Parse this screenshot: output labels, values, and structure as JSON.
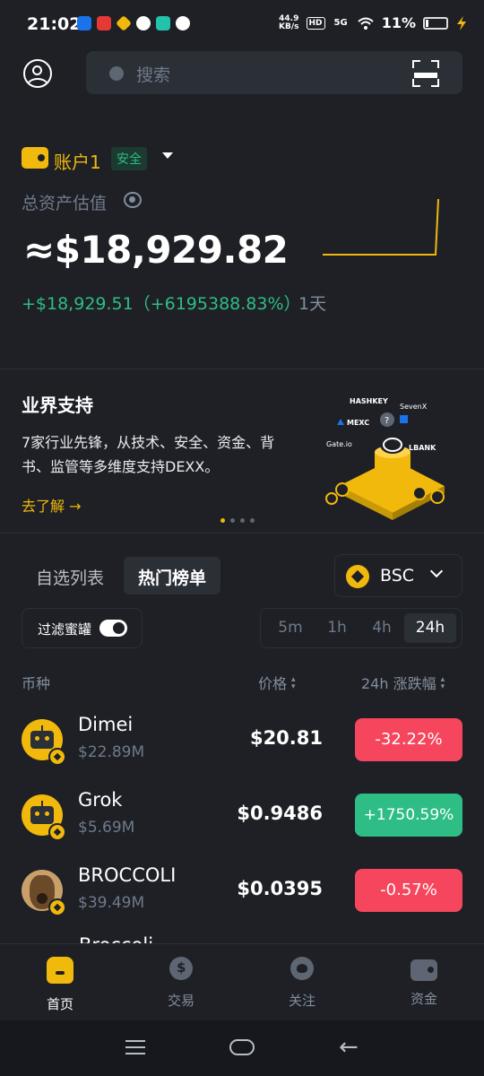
{
  "status_bar": {
    "time": "21:02",
    "net_speed_value": "44.9",
    "net_speed_unit": "KB/s",
    "hd_badge": "HD",
    "signal_label": "5G",
    "battery_pct": "11%",
    "app_icon_colors": [
      "#1a73e8",
      "#e53935",
      "#f0b90b",
      "#ffffff",
      "#22c3aa",
      "#ffffff"
    ]
  },
  "header": {
    "search_placeholder": "搜索"
  },
  "account": {
    "name": "账户1",
    "security_badge": "安全",
    "asset_label": "总资产估值",
    "balance": "≈$18,929.82",
    "pnl": "+$18,929.51（+6195388.83%）",
    "period": "1天"
  },
  "banner": {
    "title": "业界支持",
    "text": "7家行业先锋，从技术、安全、资金、背书、监管等多维度支持DEXX。",
    "link": "去了解",
    "partner_logos": [
      "HASHKEY",
      "SevenX",
      "MEXC",
      "Gate.io",
      "LBANK"
    ],
    "slide_count": 4,
    "active_slide": 1
  },
  "market": {
    "tabs": [
      "自选列表",
      "热门榜单"
    ],
    "active_tab": "热门榜单",
    "chain": "BSC",
    "filter_label": "过滤蜜罐",
    "filter_enabled": true,
    "timeframes": [
      "5m",
      "1h",
      "4h",
      "24h"
    ],
    "active_timeframe": "24h",
    "columns": {
      "token": "币种",
      "price": "价格",
      "change": "24h 涨跌幅"
    },
    "rows": [
      {
        "name": "Dimei",
        "market_cap": "$22.89M",
        "price": "$20.81",
        "change": "-32.22%",
        "direction": "down",
        "icon": "robot-icon"
      },
      {
        "name": "Grok",
        "market_cap": "$5.69M",
        "price": "$0.9486",
        "change": "+1750.59%",
        "direction": "up",
        "icon": "robot-icon"
      },
      {
        "name": "BROCCOLI",
        "market_cap": "$39.49M",
        "price": "$0.0395",
        "change": "-0.57%",
        "direction": "down",
        "icon": "dog-icon"
      }
    ],
    "partial_row_name": "Broccoli"
  },
  "bottom_nav": [
    {
      "label": "首页",
      "icon": "home-icon",
      "active": true
    },
    {
      "label": "交易",
      "icon": "trade-icon",
      "active": false
    },
    {
      "label": "关注",
      "icon": "follow-icon",
      "active": false
    },
    {
      "label": "资金",
      "icon": "wallet-icon",
      "active": false
    }
  ],
  "colors": {
    "background": "#1e2026",
    "accent": "#f0b90b",
    "up": "#2ebd85",
    "down": "#f6465d"
  }
}
